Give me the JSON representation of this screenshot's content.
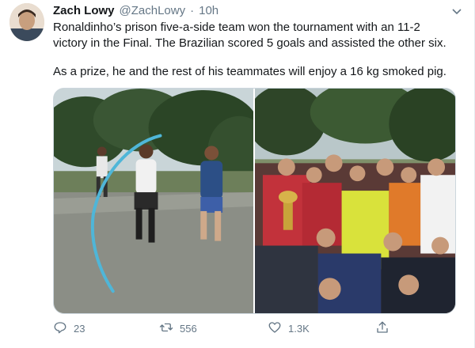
{
  "tweet": {
    "author_name": "Zach Lowy",
    "author_handle": "@ZachLowy",
    "separator": "·",
    "time": "10h",
    "paragraphs": [
      "Ronaldinho’s prison five-a-side team won the tournament with an 11-2\nvictory in the Final. The Brazilian scored 5 goals and assisted the other six.",
      "As a prize, he and the rest of his teammates will enjoy a 16 kg smoked pig."
    ]
  },
  "stats": {
    "replies": "23",
    "retweets": "556",
    "likes": "1.3K"
  },
  "icons": {
    "more": "chevron-down-icon",
    "reply": "reply-icon",
    "retweet": "retweet-icon",
    "like": "heart-icon",
    "share": "share-icon"
  },
  "colors": {
    "text": "#14171a",
    "secondary": "#657786",
    "border": "#ccd6dd",
    "annotation_circle": "#4fb6d8"
  }
}
